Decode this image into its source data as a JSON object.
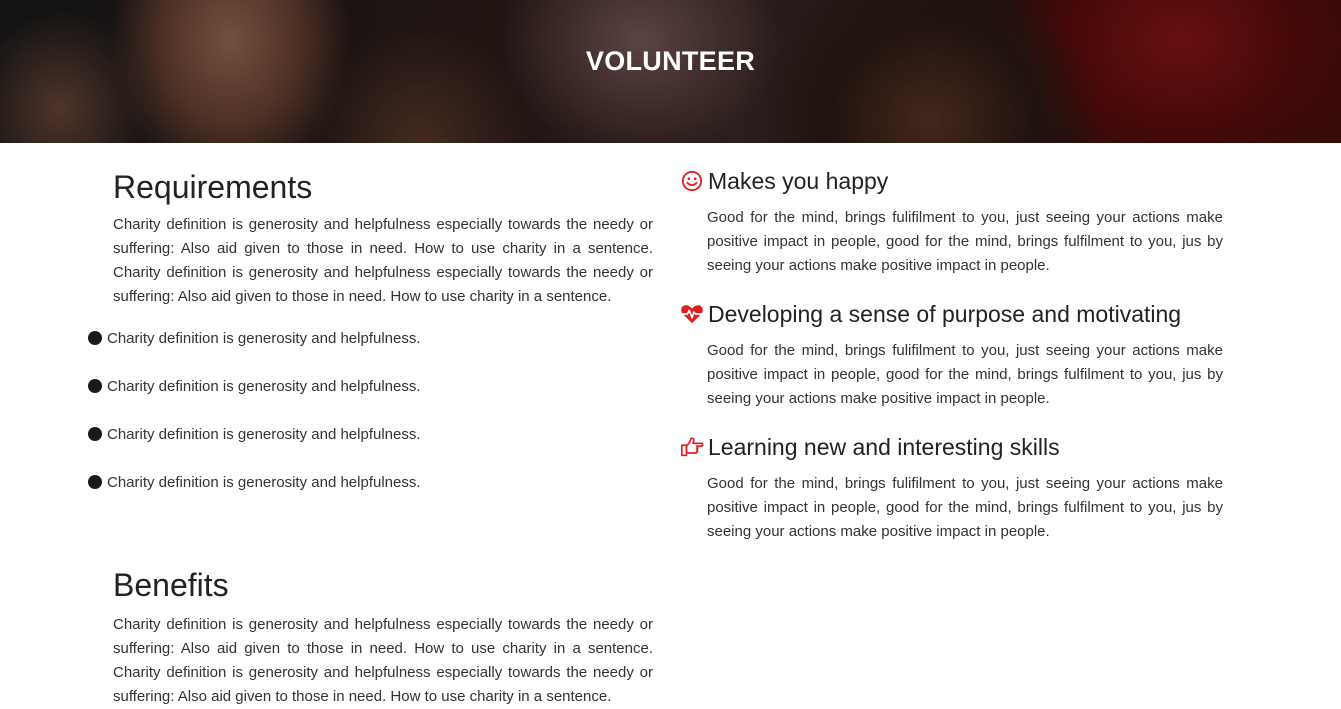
{
  "hero": {
    "title": "VOLUNTEER"
  },
  "requirements": {
    "title": "Requirements",
    "text": "Charity definition is generosity and helpfulness especially towards the needy or suffering: Also aid given to those in need. How to use charity in a sentence. Charity definition is generosity and helpfulness especially towards the needy or suffering: Also aid given to those in need. How to use charity in a sentence.",
    "bullets": [
      "Charity definition is generosity and helpfulness.",
      "Charity definition is generosity and helpfulness.",
      "Charity definition is generosity and helpfulness.",
      "Charity definition is generosity and helpfulness."
    ]
  },
  "benefits": {
    "title": "Benefits",
    "text": "Charity definition is generosity and helpfulness especially towards the needy or suffering: Also aid given to those in need. How to use charity in a sentence. Charity definition is generosity and helpfulness especially towards the needy or suffering: Also aid given to those in need. How to use charity in a sentence."
  },
  "benefit_items": [
    {
      "icon": "smile-icon",
      "title": "Makes you happy",
      "text": "Good for the mind, brings fulifilment to you, just seeing your actions make positive impact in people, good for the mind, brings fulfilment to you, jus by seeing your actions make positive impact in people."
    },
    {
      "icon": "heartbeat-icon",
      "title": "Developing a sense of purpose and motivating",
      "text": "Good for the mind, brings fulifilment to you, just seeing your actions make positive impact in people, good for the mind, brings fulfilment to you, jus by seeing your actions make positive impact in people."
    },
    {
      "icon": "hand-pointing-icon",
      "title": "Learning new and interesting skills",
      "text": "Good for the mind, brings fulifilment to you, just seeing your actions make positive impact in people, good for the mind, brings fulfilment to you, jus by seeing your actions make positive impact in people."
    }
  ],
  "colors": {
    "accent": "#e02020",
    "text": "#333333",
    "heading": "#222222"
  }
}
